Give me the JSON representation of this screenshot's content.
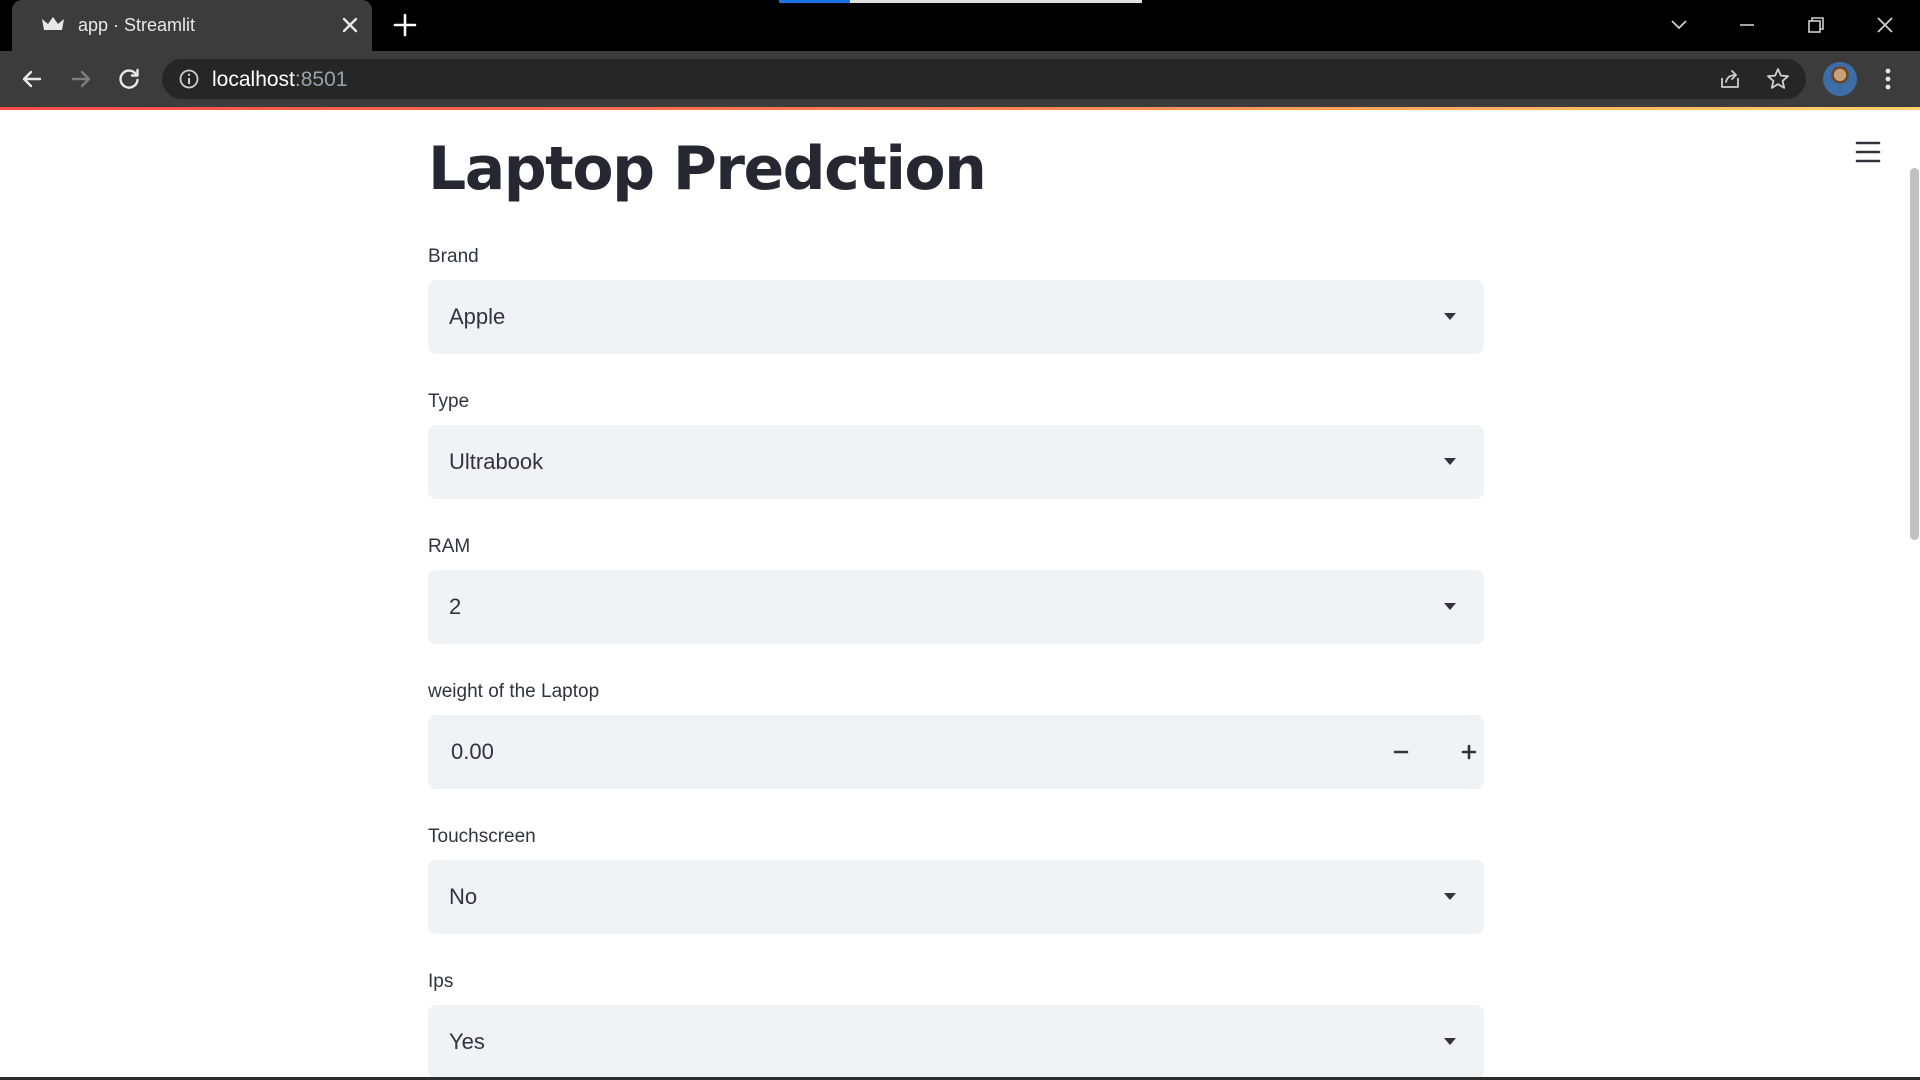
{
  "browser": {
    "tab_title": "app · Streamlit",
    "url_host": "localhost",
    "url_port": ":8501"
  },
  "app": {
    "title": "Laptop Predction",
    "fields": [
      {
        "label": "Brand",
        "value": "Apple",
        "kind": "select"
      },
      {
        "label": "Type",
        "value": "Ultrabook",
        "kind": "select"
      },
      {
        "label": "RAM",
        "value": "2",
        "kind": "select"
      },
      {
        "label": "weight of the Laptop",
        "value": "0.00",
        "kind": "number"
      },
      {
        "label": "Touchscreen",
        "value": "No",
        "kind": "select"
      },
      {
        "label": "Ips",
        "value": "Yes",
        "kind": "select"
      }
    ]
  },
  "colors": {
    "accent": "#ff4b4b",
    "widget_bg": "#f0f2f6",
    "text": "#31333f",
    "title_text": "#262730"
  },
  "icons": {
    "tab_favicon": "streamlit-crown-icon",
    "tab_close": "close-icon",
    "new_tab": "plus-icon",
    "back": "arrow-left-icon",
    "forward": "arrow-right-icon",
    "reload": "reload-icon",
    "site_info": "info-icon",
    "share": "share-icon",
    "bookmark": "star-icon",
    "browser_menu": "kebab-menu-icon",
    "app_menu": "hamburger-menu-icon",
    "select_caret": "caret-down-icon",
    "decrement": "minus-icon",
    "increment": "plus-icon"
  }
}
